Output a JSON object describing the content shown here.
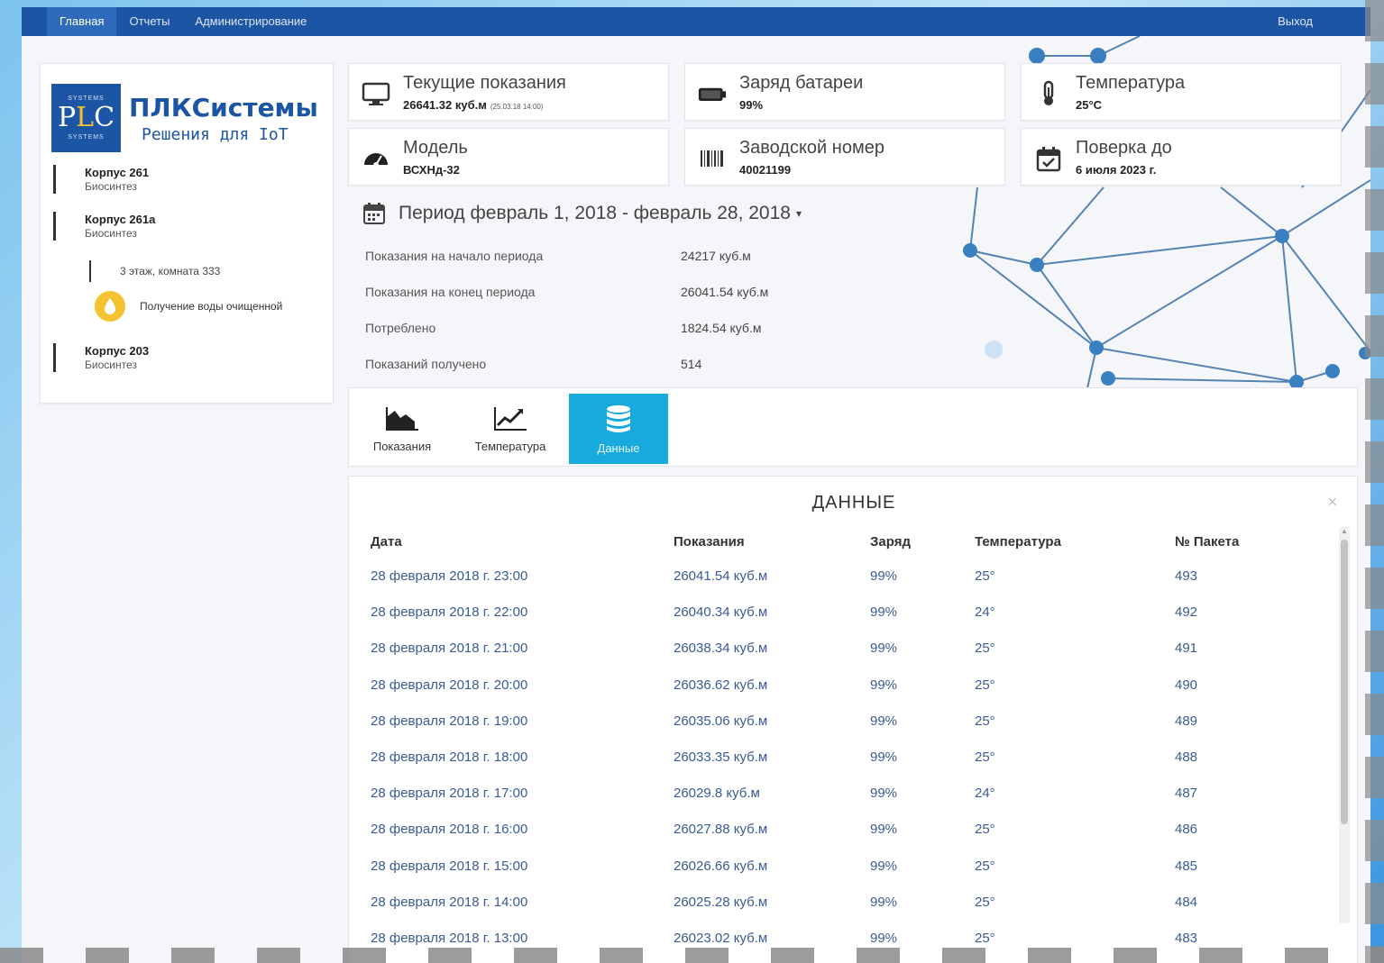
{
  "nav": {
    "items": [
      "Главная",
      "Отчеты",
      "Администрирование"
    ],
    "active_index": 0,
    "logout": "Выход"
  },
  "sidebar": {
    "logo": {
      "top_text": "SYSTEMS",
      "mark": "PLC",
      "bottom_text": "SYSTEMS"
    },
    "brand_name": "ПЛКСистемы",
    "brand_sub": "Решения для IoT",
    "tree": [
      {
        "title": "Корпус 261",
        "subtitle": "Биосинтез"
      },
      {
        "title": "Корпус 261а",
        "subtitle": "Биосинтез"
      },
      {
        "title": "Корпус 203",
        "subtitle": "Биосинтез"
      }
    ],
    "sub_item": "3 этаж, комната 333",
    "device": "Получение воды очищенной"
  },
  "cards": {
    "current": {
      "title": "Текущие показания",
      "value": "26641.32 куб.м",
      "small": "(25.03.18 14:00)",
      "icon": "monitor-icon"
    },
    "battery": {
      "title": "Заряд батареи",
      "value": "99%",
      "icon": "battery-icon"
    },
    "temperature": {
      "title": "Температура",
      "value": "25°C",
      "icon": "thermometer-icon"
    },
    "model": {
      "title": "Модель",
      "value": "ВСХНд-32",
      "icon": "gauge-icon"
    },
    "serial": {
      "title": "Заводской номер",
      "value": "40021199",
      "icon": "barcode-icon"
    },
    "calibration": {
      "title": "Поверка до",
      "value": "6 июля 2023 г.",
      "icon": "calendar-check-icon"
    }
  },
  "period": {
    "label": "Период февраль 1, 2018 - февраль 28, 2018",
    "caret": "▾"
  },
  "stats": [
    {
      "label": "Показания на начало периода",
      "value": "24217 куб.м"
    },
    {
      "label": "Показания на конец периода",
      "value": "26041.54 куб.м"
    },
    {
      "label": "Потреблено",
      "value": "1824.54 куб.м"
    },
    {
      "label": "Показаний получено",
      "value": "514"
    }
  ],
  "tabs": [
    {
      "label": "Показания",
      "icon": "area-chart-icon"
    },
    {
      "label": "Температура",
      "icon": "line-chart-icon"
    },
    {
      "label": "Данные",
      "icon": "database-icon"
    }
  ],
  "active_tab": 2,
  "data_panel": {
    "title": "ДАННЫЕ",
    "close": "×",
    "columns": [
      "Дата",
      "Показания",
      "Заряд",
      "Температура",
      "№ Пакета"
    ],
    "rows": [
      [
        "28 февраля 2018 г. 23:00",
        "26041.54 куб.м",
        "99%",
        "25°",
        "493"
      ],
      [
        "28 февраля 2018 г. 22:00",
        "26040.34 куб.м",
        "99%",
        "24°",
        "492"
      ],
      [
        "28 февраля 2018 г. 21:00",
        "26038.34 куб.м",
        "99%",
        "25°",
        "491"
      ],
      [
        "28 февраля 2018 г. 20:00",
        "26036.62 куб.м",
        "99%",
        "25°",
        "490"
      ],
      [
        "28 февраля 2018 г. 19:00",
        "26035.06 куб.м",
        "99%",
        "25°",
        "489"
      ],
      [
        "28 февраля 2018 г. 18:00",
        "26033.35 куб.м",
        "99%",
        "25°",
        "488"
      ],
      [
        "28 февраля 2018 г. 17:00",
        "26029.8 куб.м",
        "99%",
        "24°",
        "487"
      ],
      [
        "28 февраля 2018 г. 16:00",
        "26027.88 куб.м",
        "99%",
        "25°",
        "486"
      ],
      [
        "28 февраля 2018 г. 15:00",
        "26026.66 куб.м",
        "99%",
        "25°",
        "485"
      ],
      [
        "28 февраля 2018 г. 14:00",
        "26025.28 куб.м",
        "99%",
        "25°",
        "484"
      ],
      [
        "28 февраля 2018 г. 13:00",
        "26023.02 куб.м",
        "99%",
        "25°",
        "483"
      ]
    ]
  },
  "colors": {
    "nav": "#1d55a5",
    "accent": "#18a9dd",
    "link": "#3a5b92",
    "water": "#f4c430"
  }
}
